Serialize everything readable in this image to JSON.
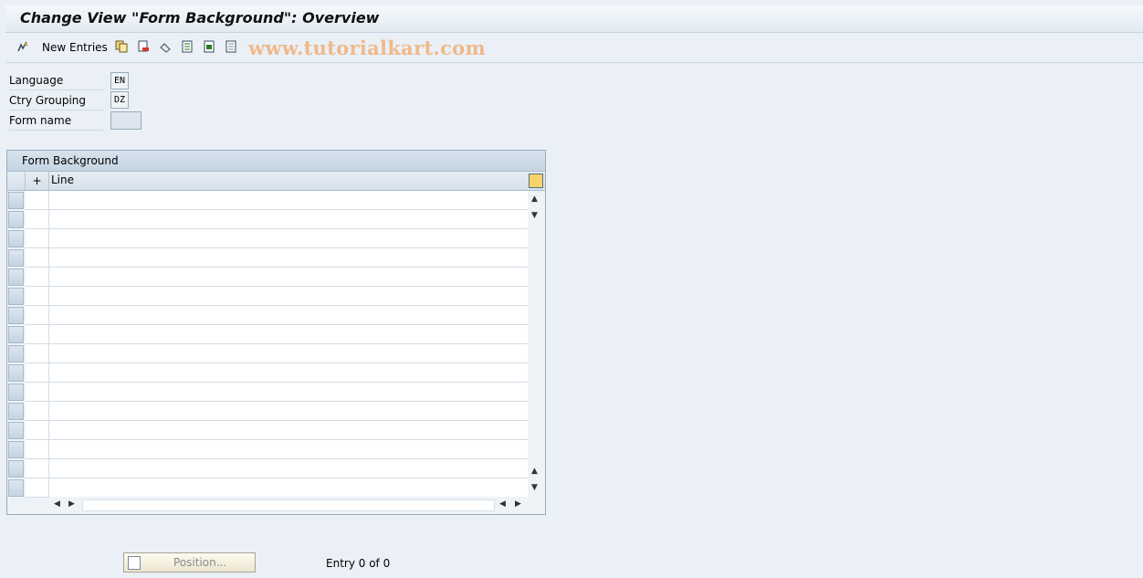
{
  "window": {
    "title": "Change View \"Form Background\": Overview"
  },
  "toolbar": {
    "new_entries_label": "New Entries",
    "watermark": "www.tutorialkart.com",
    "icons": [
      "display-change-icon",
      "copy-as-icon",
      "delete-icon",
      "undo-change-icon",
      "select-all-icon",
      "select-block-icon",
      "deselect-all-icon"
    ]
  },
  "fields": {
    "language": {
      "label": "Language",
      "value": "EN"
    },
    "ctry_grouping": {
      "label": "Ctry Grouping",
      "value": "DZ"
    },
    "form_name": {
      "label": "Form name",
      "value": ""
    }
  },
  "table": {
    "title": "Form Background",
    "columns": [
      "+",
      "Line"
    ],
    "rows": [
      "",
      "",
      "",
      "",
      "",
      "",
      "",
      "",
      "",
      "",
      "",
      "",
      "",
      "",
      "",
      ""
    ]
  },
  "footer": {
    "position_label": "Position...",
    "entry_text": "Entry 0 of 0"
  }
}
